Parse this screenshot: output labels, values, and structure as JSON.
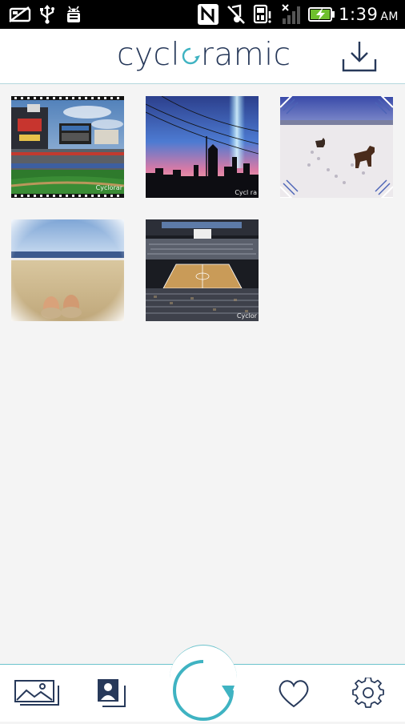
{
  "status_bar": {
    "time": "1:39",
    "ampm": "AM",
    "icons": [
      "sd-card-icon",
      "usb-icon",
      "android-debug-icon",
      "nfc-icon",
      "mute-icon",
      "sim-icon",
      "signal-icon",
      "battery-charging-icon"
    ]
  },
  "header": {
    "brand_prefix": "cycl",
    "brand_suffix": "ramic",
    "download_icon": "download-icon"
  },
  "colors": {
    "brand_text": "#27395a",
    "accent_teal": "#3fb3c2",
    "divider": "#b4d8dd",
    "background": "#f4f4f4"
  },
  "photos": [
    {
      "name": "photo-baseball-stadium",
      "subject": "Baseball stadium",
      "watermark": "Cyclorar"
    },
    {
      "name": "photo-city-sunset",
      "subject": "City skyline at dusk",
      "watermark": "Cycl ra"
    },
    {
      "name": "photo-dog-beach",
      "subject": "Dog on snowy beach",
      "watermark": ""
    },
    {
      "name": "photo-beach-feet",
      "subject": "Feet in sand at the beach",
      "watermark": ""
    },
    {
      "name": "photo-basketball-arena",
      "subject": "Basketball arena",
      "watermark": "Cyclor"
    }
  ],
  "bottom_nav": {
    "items": [
      {
        "name": "gallery-icon"
      },
      {
        "name": "profile-photos-icon"
      },
      {
        "name": "cycle-icon"
      },
      {
        "name": "heart-icon"
      },
      {
        "name": "settings-gear-icon"
      }
    ]
  }
}
